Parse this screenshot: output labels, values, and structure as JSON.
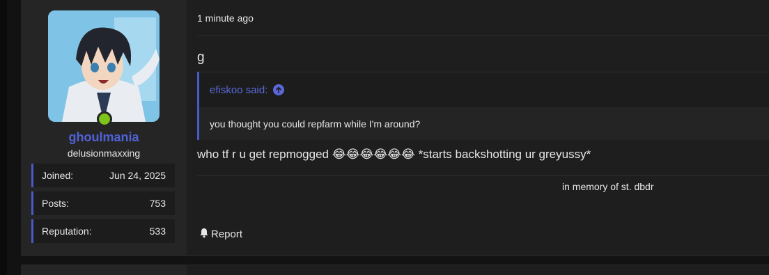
{
  "post": {
    "user": {
      "username": "ghoulmania",
      "user_title": "delusionmaxxing",
      "online": true,
      "stats": [
        {
          "label": "Joined:",
          "value": "Jun 24, 2025"
        },
        {
          "label": "Posts:",
          "value": "753"
        },
        {
          "label": "Reputation:",
          "value": "533"
        }
      ]
    },
    "timestamp": "1 minute ago",
    "first_line": "g",
    "quote": {
      "author_said": "efiskoo said:",
      "text": "you thought you could repfarm while I'm around?"
    },
    "message": "who tf r u get repmogged 😂😂😂😂😂😂 *starts backshotting ur greyussy*",
    "signature": "in memory of st. dbdr",
    "actions": {
      "report_label": "Report"
    }
  },
  "colors": {
    "accent": "#4a59c9",
    "username": "#5061d6",
    "online": "#7ec41a"
  }
}
